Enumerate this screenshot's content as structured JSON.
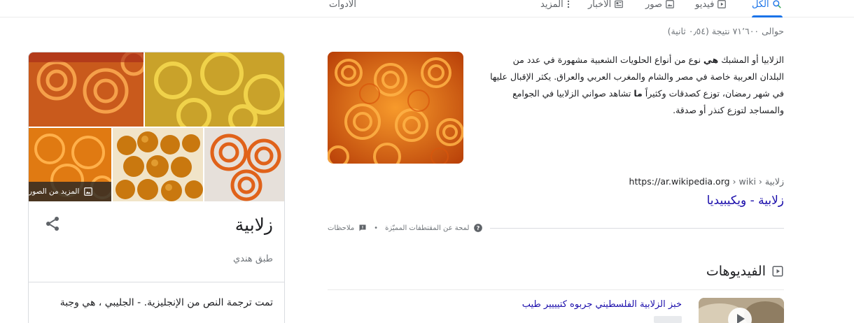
{
  "tabs": [
    {
      "label": "الكل",
      "icon": "search-icon",
      "active": true
    },
    {
      "label": "فيديو",
      "icon": "video-icon"
    },
    {
      "label": "صور",
      "icon": "image-icon"
    },
    {
      "label": "الأخبار",
      "icon": "news-icon"
    },
    {
      "label": "المزيد",
      "icon": "more-vert-icon"
    },
    {
      "label": "الأدوات"
    }
  ],
  "results_count": "حوالى ٧١٬٦٠٠ نتيجة (٠٫٥٤ ثانية)",
  "snippet": {
    "text_pre": "الزلابيا أو المشبك ",
    "text_bold1": "هي",
    "text_mid": " نوع من أنواع الحلويات الشعبية مشهورة في عدد من البلدان العربية خاصة في مصر والشام والمغرب العربي والعراق. يكثر الإقبال عليها في شهر رمضان، توزع كصدقات وكثيراً ",
    "text_bold2": "ما",
    "text_post": " تشاهد صواني الزلابيا في الجوامع والمساجد لتوزع كنذر أو صدقة.",
    "source_domain": "https://ar.wikipedia.org",
    "source_path": " › wiki › زلابية",
    "source_title": "زلابية - ويكيبيديا",
    "feedback_about": "لمحة عن المقتطفات المميّزة",
    "feedback_notes": "ملاحظات"
  },
  "videos": {
    "header": "الفيديوهات",
    "first_title": "خبز الزلابية الفلسطيني جربوه كتيييير طيب"
  },
  "knowledge_panel": {
    "title": "زلابية",
    "subtitle": "طبق هندي",
    "more_images": "المزيد من الصور",
    "description": "تمت ترجمة النص من الإنجليزية. - الجليبي ، هي وجبة"
  },
  "colors": {
    "accent": "#1a73e8",
    "link": "#1a0dab",
    "jalebi_orange": "#e8791a"
  }
}
